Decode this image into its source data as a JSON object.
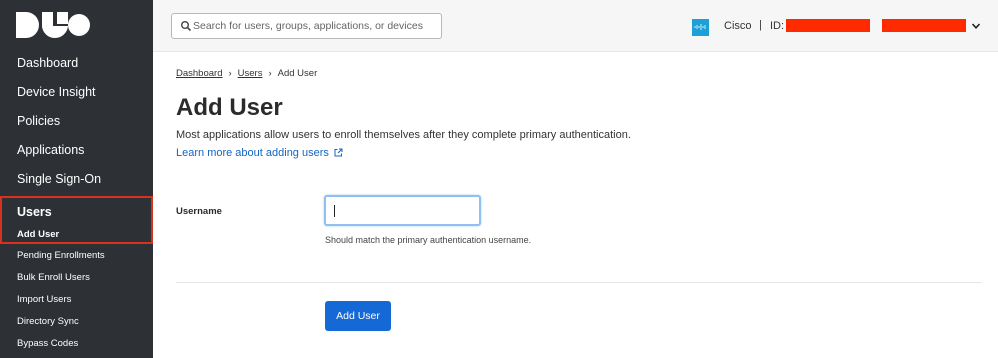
{
  "brand": {
    "logo_text": "DUO",
    "accent": "#1469d6",
    "sidebar_bg": "#2d3035",
    "highlight": "#d8321f"
  },
  "sidebar": {
    "items": [
      {
        "label": "Dashboard"
      },
      {
        "label": "Device Insight"
      },
      {
        "label": "Policies"
      },
      {
        "label": "Applications"
      },
      {
        "label": "Single Sign-On"
      },
      {
        "label": "Users"
      }
    ],
    "sub_items": [
      {
        "label": "Add User"
      },
      {
        "label": "Pending Enrollments"
      },
      {
        "label": "Bulk Enroll Users"
      },
      {
        "label": "Import Users"
      },
      {
        "label": "Directory Sync"
      },
      {
        "label": "Bypass Codes"
      }
    ]
  },
  "topbar": {
    "search_placeholder": "Search for users, groups, applications, or devices",
    "account_name": "Cisco",
    "separator": "|",
    "id_label": "ID:"
  },
  "breadcrumb": {
    "items": [
      "Dashboard",
      "Users",
      "Add User"
    ]
  },
  "page": {
    "title": "Add User",
    "description": "Most applications allow users to enroll themselves after they complete primary authentication.",
    "learn_more": "Learn more about adding users"
  },
  "form": {
    "username_label": "Username",
    "username_value": "",
    "username_hint": "Should match the primary authentication username.",
    "submit_label": "Add User"
  }
}
